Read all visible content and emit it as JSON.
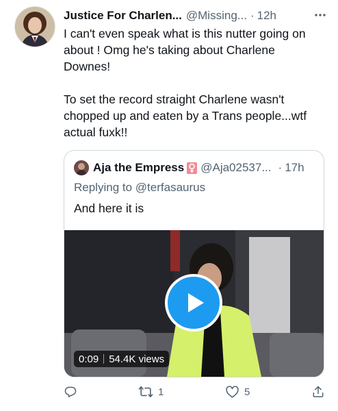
{
  "tweet": {
    "author_name": "Justice For Charlen...",
    "author_handle": "@Missing...",
    "separator": "·",
    "time": "12h",
    "more_icon": "more-dots-icon",
    "text_paragraph_1": "I can't even speak what is this nutter going on about ! Omg he's taking about Charlene Downes!",
    "text_paragraph_2": "To set the record straight Charlene wasn't chopped up and eaten by a Trans people...wtf actual fuxk!!"
  },
  "quoted_tweet": {
    "author_name": "Aja the Empress",
    "flag_icon": "female-sign-flag-icon",
    "author_handle": "@Aja02537...",
    "separator": "·",
    "time": "17h",
    "replying_prefix": "Replying to",
    "replying_to": "@terfasaurus",
    "text": "And here it is",
    "video": {
      "elapsed": "0:09",
      "views": "54.4K views",
      "play_icon": "play-icon"
    }
  },
  "actions": {
    "reply_icon": "reply-icon",
    "retweet_count": "1",
    "like_count": "5",
    "share_icon": "share-icon"
  },
  "colors": {
    "text_primary": "#0f1419",
    "text_secondary": "#536471",
    "accent": "#1d9bf0",
    "border": "#cfd9de"
  }
}
